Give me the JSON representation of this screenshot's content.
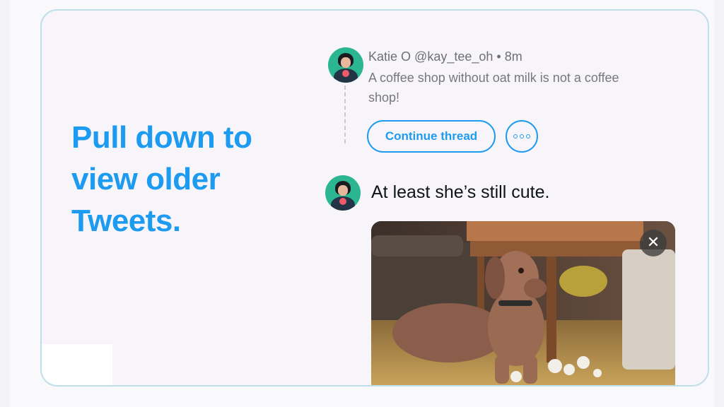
{
  "headline": "Pull down to view older Tweets.",
  "thread_tweet": {
    "name": "Katie O",
    "handle": "@kay_tee_oh",
    "separator": "•",
    "time": "8m",
    "text": "A coffee shop without oat milk is not a coffee shop!"
  },
  "actions": {
    "continue_label": "Continue thread",
    "more_icon": "more-dots-icon"
  },
  "reply_tweet": {
    "text": "At least she’s still cute.",
    "media": {
      "description_icon": "dog-photo",
      "close_symbol": "✕"
    }
  },
  "colors": {
    "accent": "#1d9bf0",
    "card_border": "#bfe0ea",
    "card_bg": "#f8f5fa"
  }
}
